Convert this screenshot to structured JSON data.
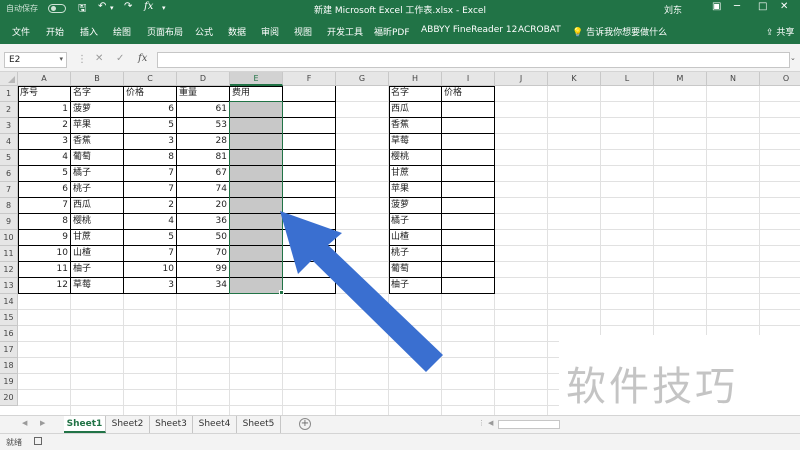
{
  "titlebar": {
    "autosave_label": "自动保存",
    "doc_title": "新建 Microsoft Excel 工作表.xlsx  -  Excel",
    "user": "刘东"
  },
  "ribbon": {
    "tabs": [
      "文件",
      "开始",
      "插入",
      "绘图",
      "页面布局",
      "公式",
      "数据",
      "审阅",
      "视图",
      "开发工具",
      "福昕PDF",
      "ABBYY FineReader 12",
      "ACROBAT"
    ],
    "tell_me": "告诉我你想要做什么",
    "share": "共享"
  },
  "formula_bar": {
    "name_box": "E2",
    "fx_label": "fx",
    "formula": ""
  },
  "grid": {
    "columns": [
      "A",
      "B",
      "C",
      "D",
      "E",
      "F",
      "G",
      "H",
      "I",
      "J",
      "K",
      "L",
      "M",
      "N",
      "O"
    ],
    "rows": [
      "1",
      "2",
      "3",
      "4",
      "5",
      "6",
      "7",
      "8",
      "9",
      "10",
      "11",
      "12",
      "13",
      "14",
      "15",
      "16",
      "17",
      "18",
      "19",
      "20"
    ],
    "selected_column": "E",
    "table1": {
      "headers": [
        "序号",
        "名字",
        "价格",
        "重量",
        "费用"
      ],
      "rows": [
        [
          "1",
          "菠萝",
          "6",
          "61"
        ],
        [
          "2",
          "苹果",
          "5",
          "53"
        ],
        [
          "3",
          "香蕉",
          "3",
          "28"
        ],
        [
          "4",
          "葡萄",
          "8",
          "81"
        ],
        [
          "5",
          "橘子",
          "7",
          "67"
        ],
        [
          "6",
          "桃子",
          "7",
          "74"
        ],
        [
          "7",
          "西瓜",
          "2",
          "20"
        ],
        [
          "8",
          "樱桃",
          "4",
          "36"
        ],
        [
          "9",
          "甘蔗",
          "5",
          "50"
        ],
        [
          "10",
          "山楂",
          "7",
          "70"
        ],
        [
          "11",
          "柚子",
          "10",
          "99"
        ],
        [
          "12",
          "草莓",
          "3",
          "34"
        ]
      ]
    },
    "table2": {
      "headers": [
        "名字",
        "价格"
      ],
      "names": [
        "西瓜",
        "香蕉",
        "草莓",
        "樱桃",
        "甘蔗",
        "苹果",
        "菠萝",
        "橘子",
        "山楂",
        "桃子",
        "葡萄",
        "柚子"
      ]
    }
  },
  "sheets": {
    "tabs": [
      "Sheet1",
      "Sheet2",
      "Sheet3",
      "Sheet4",
      "Sheet5"
    ],
    "active": "Sheet1",
    "add_label": "+"
  },
  "status": {
    "ready": "就绪"
  },
  "overlay": {
    "watermark": "软件技巧",
    "arrow_color": "#3a6fd0"
  },
  "colors": {
    "excel_green": "#217346",
    "fill_gray": "#c8c8c8"
  }
}
